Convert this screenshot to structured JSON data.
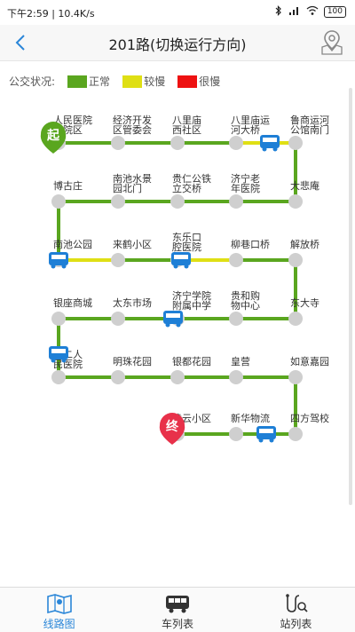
{
  "status_bar": {
    "time": "下午2:59",
    "speed": "10.4K/s",
    "battery": "100"
  },
  "header": {
    "title": "201路(切换运行方向)"
  },
  "legend": {
    "label": "公交状况:",
    "items": [
      {
        "label": "正常",
        "color": "#5aa61f"
      },
      {
        "label": "较慢",
        "color": "#dfdf14"
      },
      {
        "label": "很慢",
        "color": "#ee1111"
      }
    ]
  },
  "route": {
    "start_badge": "起",
    "end_badge": "终",
    "rows": [
      {
        "dir": "right",
        "stops": [
          "人民医院西院区",
          "经济开发区管委会",
          "八里庙西社区",
          "八里庙运河大桥",
          "鲁商运河公馆南门"
        ],
        "segments": [
          "normal",
          "normal",
          "normal",
          "slow"
        ]
      },
      {
        "dir": "left",
        "stops": [
          "大悲庵",
          "济宁老年医院",
          "贵仁公铁立交桥",
          "南池水景园北门",
          "博古庄"
        ],
        "segments": [
          "normal",
          "normal",
          "normal",
          "normal"
        ]
      },
      {
        "dir": "right",
        "stops": [
          "南池公园",
          "来鹤小区",
          "东乐口腔医院",
          "柳巷口桥",
          "解放桥"
        ],
        "segments": [
          "slow",
          "normal",
          "slow",
          "normal"
        ]
      },
      {
        "dir": "left",
        "stops": [
          "东大寺",
          "贵和购物中心",
          "济宁学院附属中学",
          "太东市场",
          "银座商城"
        ],
        "segments": [
          "normal",
          "normal",
          "normal",
          "normal"
        ]
      },
      {
        "dir": "right",
        "stops": [
          "第二人民医院",
          "明珠花园",
          "银都花园",
          "皇营",
          "如意嘉园"
        ],
        "segments": [
          "normal",
          "normal",
          "normal",
          "normal"
        ]
      },
      {
        "dir": "left",
        "stops": [
          "四方驾校",
          "新华物流",
          "凌云小区"
        ],
        "segments": [
          "normal",
          "normal"
        ]
      }
    ],
    "connectors": [
      "normal",
      "normal",
      "normal",
      "normal",
      "normal"
    ]
  },
  "tabs": [
    {
      "label": "线路图",
      "icon": "map-icon",
      "active": true
    },
    {
      "label": "车列表",
      "icon": "bus-icon",
      "active": false
    },
    {
      "label": "站列表",
      "icon": "route-search-icon",
      "active": false
    }
  ]
}
